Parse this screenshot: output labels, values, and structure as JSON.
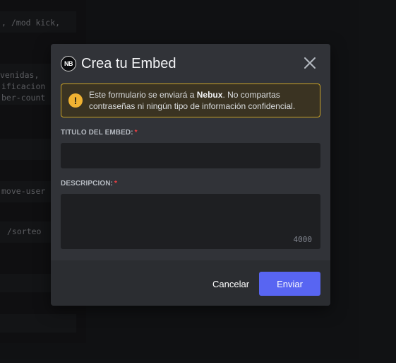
{
  "background": {
    "snippets": [
      ", /mod kick,",
      "venidas,",
      "ificacion",
      "ber-count",
      "move-user",
      "/sorteo"
    ]
  },
  "modal": {
    "avatar_text": "NB",
    "title": "Crea tu Embed",
    "close_icon": "close-icon",
    "warning": {
      "icon": "exclamation-icon",
      "text_before": "Este formulario se enviará a ",
      "app_name": "Nebux",
      "text_after": ". No compartas contraseñas ni ningún tipo de información confidencial."
    },
    "fields": [
      {
        "label": "TITULO DEL EMBED:",
        "required_mark": "*",
        "value": "",
        "placeholder": ""
      },
      {
        "label": "DESCRIPCION:",
        "required_mark": "*",
        "value": "",
        "placeholder": "",
        "max_chars": "4000"
      }
    ],
    "buttons": {
      "cancel": "Cancelar",
      "submit": "Enviar"
    }
  },
  "colors": {
    "accent": "#5865f2",
    "warning_border": "#c9a226",
    "warning_icon": "#f0b232",
    "required": "#f23f43",
    "modal_bg": "#313338"
  }
}
